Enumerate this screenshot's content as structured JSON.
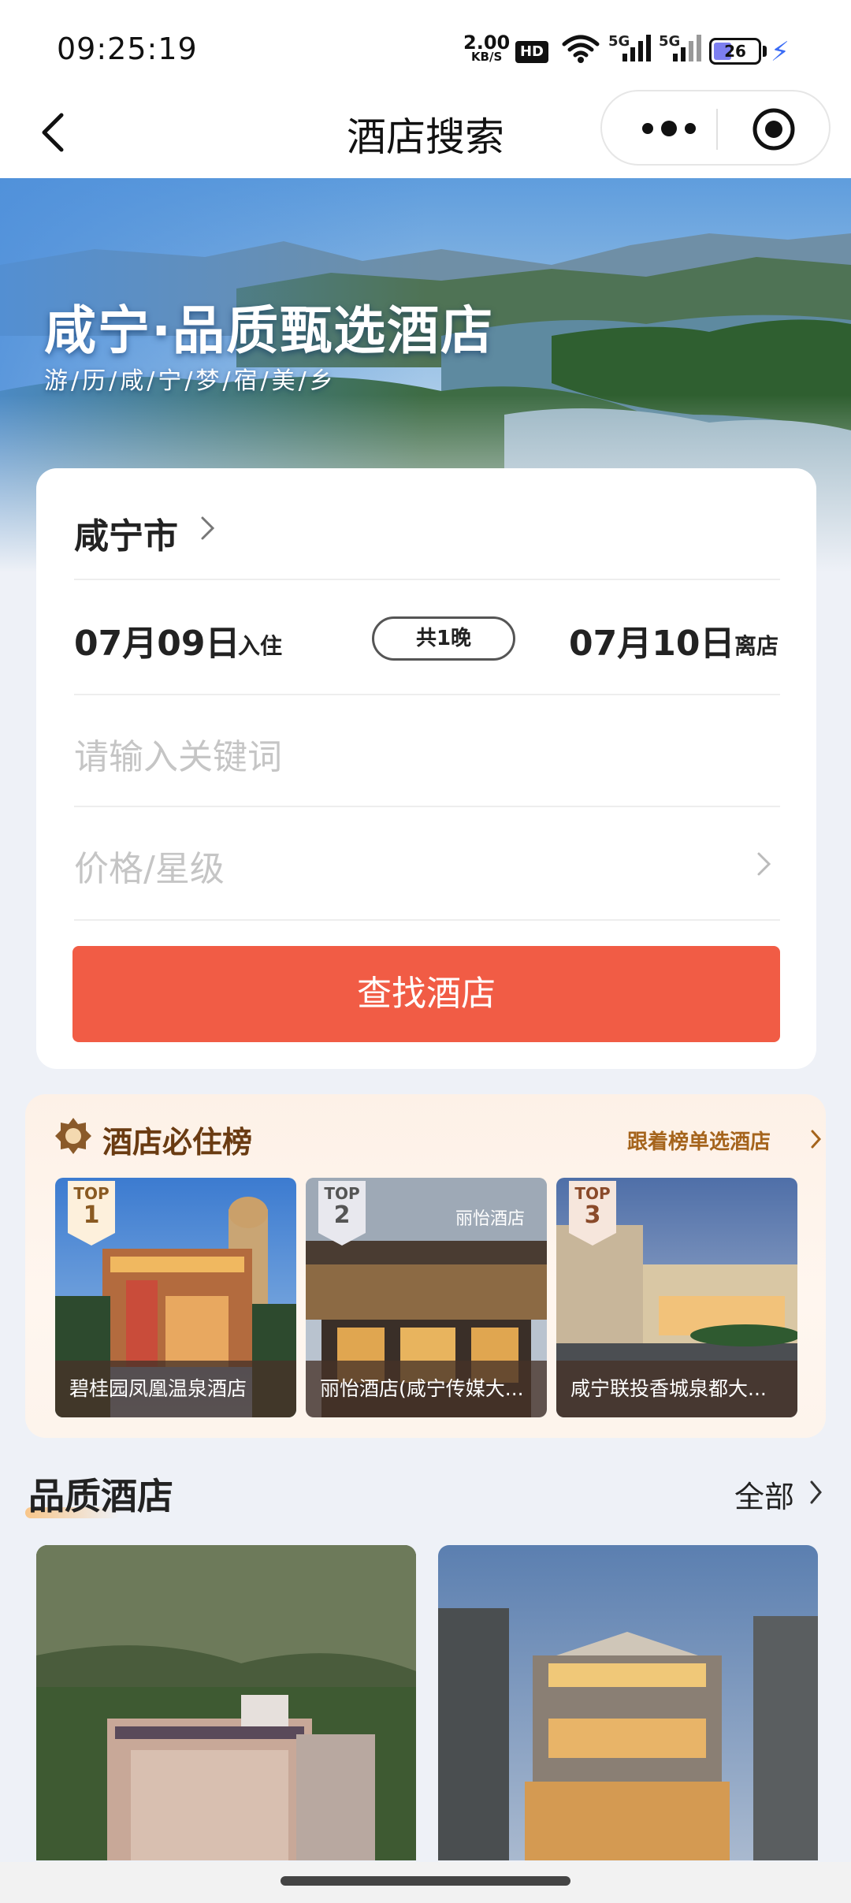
{
  "status_bar": {
    "time": "09:25:19",
    "net_speed": "2.00",
    "net_unit": "KB/S",
    "hd": "HD",
    "sig1": "5G",
    "sig2": "5G",
    "battery": "26"
  },
  "navbar": {
    "title": "酒店搜索"
  },
  "banner": {
    "title": "咸宁·品质甄选酒店",
    "subtitle": "游/历/咸/宁/梦/宿/美/乡"
  },
  "search": {
    "city": "咸宁市",
    "checkin_date": "07月09日",
    "checkin_label": "入住",
    "nights": "共1晚",
    "checkout_date": "07月10日",
    "checkout_label": "离店",
    "keyword_placeholder": "请输入关键词",
    "price_placeholder": "价格/星级",
    "button": "查找酒店"
  },
  "ranking": {
    "title": "酒店必住榜",
    "more": "跟着榜单选酒店",
    "items": [
      {
        "top": "TOP",
        "rank": "1",
        "name": "碧桂园凤凰温泉酒店"
      },
      {
        "top": "TOP",
        "rank": "2",
        "name": "丽怡酒店(咸宁传媒大..."
      },
      {
        "top": "TOP",
        "rank": "3",
        "name": "咸宁联投香城泉都大..."
      }
    ],
    "photo_sign_2": "丽怡酒店"
  },
  "quality": {
    "title": "品质酒店",
    "all": "全部"
  },
  "colors": {
    "accent": "#f15c45",
    "rank_title": "#6a3b12",
    "rank_more": "#a5641c"
  }
}
